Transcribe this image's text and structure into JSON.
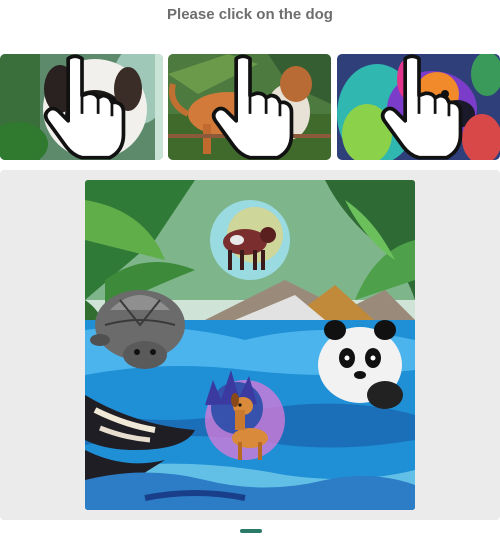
{
  "prompt": {
    "text": "Please click on the dog"
  },
  "examples": [
    {
      "name": "example-dog-1",
      "icon": "pointer-hand-icon"
    },
    {
      "name": "example-dog-2",
      "icon": "pointer-hand-icon"
    },
    {
      "name": "example-dog-3",
      "icon": "pointer-hand-icon"
    }
  ],
  "challenge": {
    "subjects": [
      "cow",
      "turtle",
      "panda",
      "dog",
      "killer-whale"
    ],
    "colors": {
      "panel": "#ebebeb",
      "water": "#1f8fd6",
      "jungle": "#3c7b3a"
    }
  }
}
